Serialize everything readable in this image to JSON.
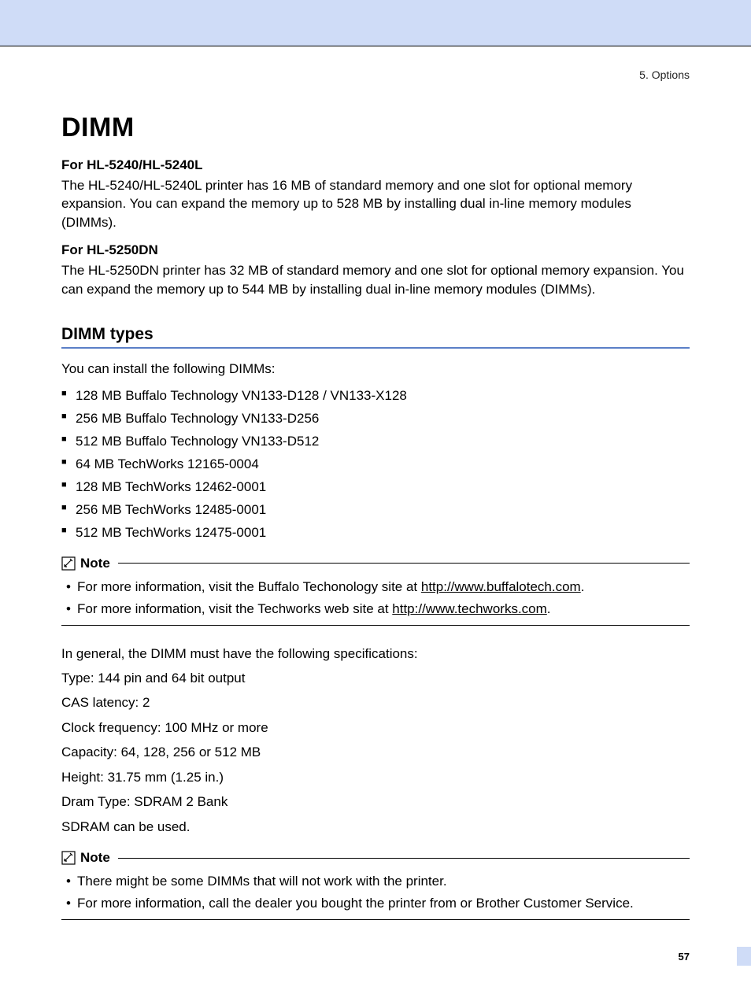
{
  "breadcrumb": "5. Options",
  "title": "DIMM",
  "model1": {
    "heading": "For HL-5240/HL-5240L",
    "body": "The HL-5240/HL-5240L printer has 16 MB of standard memory and one slot for optional memory expansion. You can expand the memory up to 528 MB by installing dual in-line memory modules (DIMMs)."
  },
  "model2": {
    "heading": "For HL-5250DN",
    "body": "The HL-5250DN printer has 32 MB of standard memory and one slot for optional memory expansion. You can expand the memory up to 544 MB by installing dual in-line memory modules (DIMMs)."
  },
  "section_heading": "DIMM types",
  "intro": "You can install the following DIMMs:",
  "dimms": [
    "128 MB Buffalo Technology VN133-D128 / VN133-X128",
    "256 MB Buffalo Technology VN133-D256",
    "512 MB Buffalo Technology VN133-D512",
    "64 MB TechWorks 12165-0004",
    "128 MB TechWorks 12462-0001",
    "256 MB TechWorks 12485-0001",
    "512 MB TechWorks 12475-0001"
  ],
  "note1": {
    "label": "Note",
    "items": [
      {
        "pre": "For more information, visit the Buffalo Techonology site at ",
        "link": "http://www.buffalotech.com",
        "post": "."
      },
      {
        "pre": "For more information, visit the Techworks web site at ",
        "link": "http://www.techworks.com",
        "post": "."
      }
    ]
  },
  "specs_intro": "In general, the DIMM must have the following specifications:",
  "specs": [
    "Type: 144 pin and 64 bit output",
    "CAS latency: 2",
    "Clock frequency: 100 MHz or more",
    "Capacity: 64, 128, 256 or 512 MB",
    "Height: 31.75 mm (1.25 in.)",
    "Dram Type: SDRAM 2 Bank",
    "SDRAM can be used."
  ],
  "note2": {
    "label": "Note",
    "items": [
      {
        "pre": "There might be some DIMMs that will not work with the printer.",
        "link": "",
        "post": ""
      },
      {
        "pre": "For more information, call the dealer you bought the printer from or Brother Customer Service.",
        "link": "",
        "post": ""
      }
    ]
  },
  "page_number": "57"
}
